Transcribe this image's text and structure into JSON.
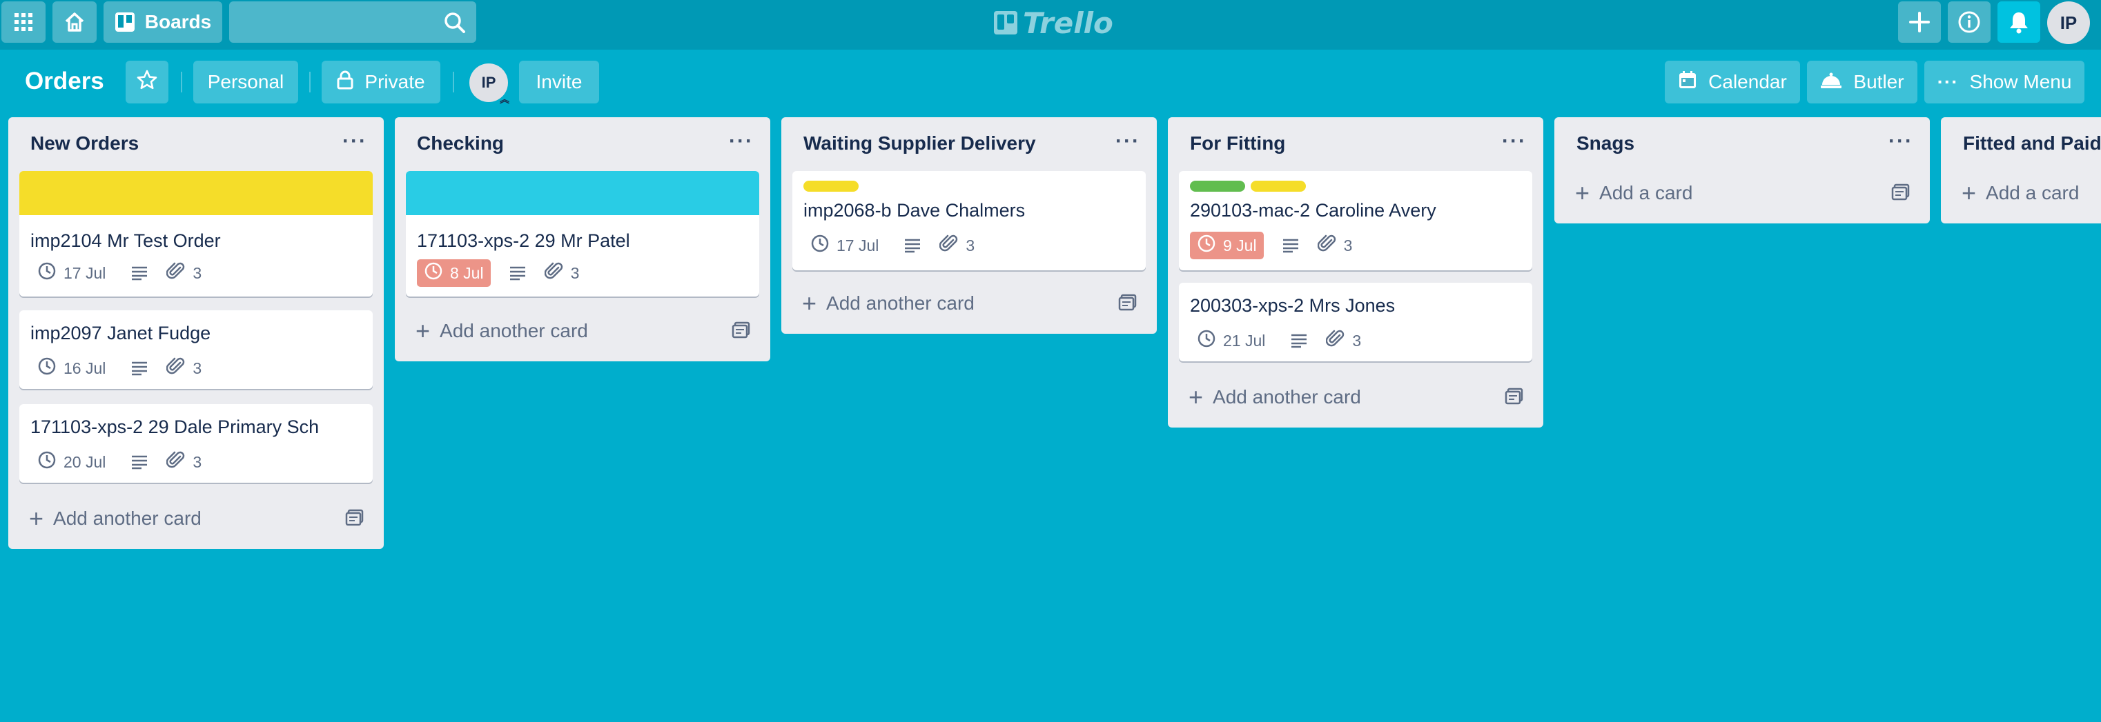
{
  "topbar": {
    "boards_label": "Boards",
    "search_placeholder": "",
    "logo_text": "Trello",
    "user_initials": "IP"
  },
  "board": {
    "title": "Orders",
    "visibility_team": "Personal",
    "visibility_privacy": "Private",
    "member_initials": "IP",
    "invite_label": "Invite",
    "calendar_label": "Calendar",
    "butler_label": "Butler",
    "show_menu_label": "Show Menu"
  },
  "colors": {
    "board_bg": "#00aecc",
    "label_yellow": "#f5dd29",
    "label_green": "#61bd4f",
    "cover_cyan": "#29cce5",
    "overdue": "#ec9488"
  },
  "lists": [
    {
      "title": "New Orders",
      "add_label": "Add another card",
      "cards": [
        {
          "cover": "yellow",
          "title": "imp2104 Mr Test Order",
          "due": "17 Jul",
          "overdue": false,
          "attachments": "3"
        },
        {
          "title": "imp2097 Janet Fudge",
          "due": "16 Jul",
          "overdue": false,
          "attachments": "3"
        },
        {
          "title": "171103-xps-2 29 Dale Primary Sch",
          "due": "20 Jul",
          "overdue": false,
          "attachments": "3"
        }
      ]
    },
    {
      "title": "Checking",
      "add_label": "Add another card",
      "cards": [
        {
          "cover": "cyan",
          "title": "171103-xps-2 29 Mr Patel",
          "due": "8 Jul",
          "overdue": true,
          "attachments": "3"
        }
      ]
    },
    {
      "title": "Waiting Supplier Delivery",
      "add_label": "Add another card",
      "cards": [
        {
          "labels": [
            "yellow"
          ],
          "title": "imp2068-b Dave Chalmers",
          "due": "17 Jul",
          "overdue": false,
          "attachments": "3"
        }
      ]
    },
    {
      "title": "For Fitting",
      "add_label": "Add another card",
      "cards": [
        {
          "labels": [
            "green",
            "yellow"
          ],
          "title": "290103-mac-2 Caroline Avery",
          "due": "9 Jul",
          "overdue": true,
          "attachments": "3"
        },
        {
          "title": "200303-xps-2 Mrs Jones",
          "due": "21 Jul",
          "overdue": false,
          "attachments": "3"
        }
      ]
    },
    {
      "title": "Snags",
      "add_label": "Add a card",
      "cards": []
    },
    {
      "title": "Fitted and Paid",
      "add_label": "Add a card",
      "cards": []
    }
  ]
}
